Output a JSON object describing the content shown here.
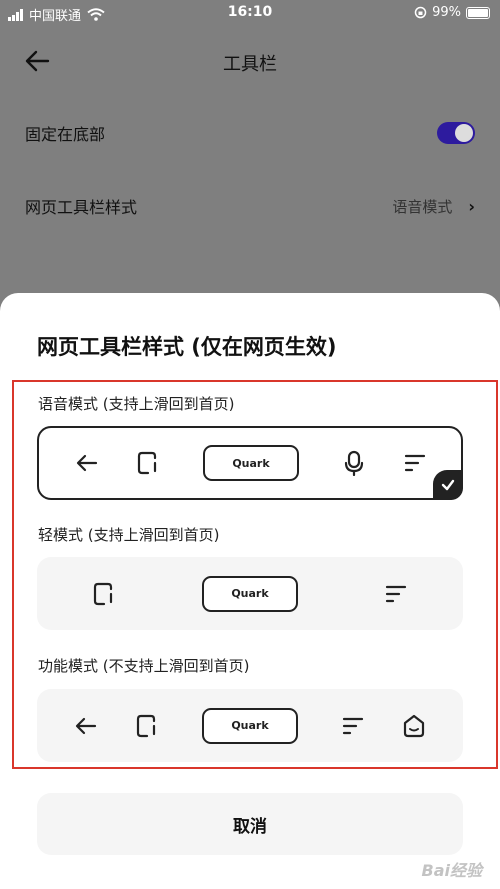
{
  "status_bar": {
    "carrier": "中国联通",
    "time": "16:10",
    "battery_percent": "99%"
  },
  "header": {
    "title": "工具栏"
  },
  "settings": {
    "pin_bottom_label": "固定在底部",
    "pin_bottom_on": true,
    "style_label": "网页工具栏样式",
    "style_value": "语音模式",
    "chevron": "›"
  },
  "sheet": {
    "title": "网页工具栏样式 (仅在网页生效)",
    "options": [
      {
        "label": "语音模式 (支持上滑回到首页)",
        "selected": true,
        "quark_label": "Quark"
      },
      {
        "label": "轻模式 (支持上滑回到首页)",
        "selected": false,
        "quark_label": "Quark"
      },
      {
        "label": "功能模式 (不支持上滑回到首页)",
        "selected": false,
        "quark_label": "Quark"
      }
    ],
    "cancel_label": "取消"
  },
  "watermark": "Bai经验",
  "colors": {
    "toggle_on": "#2d1b9e",
    "highlight_border": "#d9362b",
    "overlay": "#7f7f7f"
  }
}
